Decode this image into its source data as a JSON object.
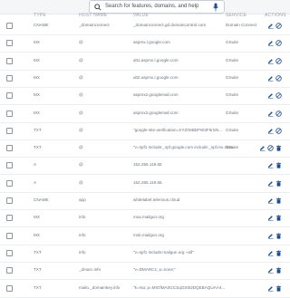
{
  "search": {
    "placeholder_text": "Search for features, domains, and help"
  },
  "colors": {
    "accent": "#1f4f8a",
    "border": "#c9ced4"
  },
  "columns": [
    "TYPE",
    "HOST NAME",
    "VALUE",
    "SERVICE",
    "ACTIONS"
  ],
  "records": [
    {
      "type": "CNAME",
      "host": "_domainconnect",
      "value": "_domainconnect.gd.domaincontrol.com",
      "service": "Domain Connect",
      "actions": [
        "edit",
        "block"
      ]
    },
    {
      "type": "MX",
      "host": "@",
      "value": "aspmx.l.google.com",
      "service": "GSuite",
      "actions": [
        "edit",
        "block"
      ]
    },
    {
      "type": "MX",
      "host": "@",
      "value": "alt1.aspmx.l.google.com",
      "service": "GSuite",
      "actions": [
        "edit",
        "block"
      ]
    },
    {
      "type": "MX",
      "host": "@",
      "value": "alt2.aspmx.l.google.com",
      "service": "GSuite",
      "actions": [
        "edit",
        "block"
      ]
    },
    {
      "type": "MX",
      "host": "@",
      "value": "aspmx2.googlemail.com",
      "service": "GSuite",
      "actions": [
        "edit",
        "block"
      ]
    },
    {
      "type": "MX",
      "host": "@",
      "value": "aspmx3.googlemail.com",
      "service": "GSuite",
      "actions": [
        "edit",
        "block"
      ]
    },
    {
      "type": "TXT",
      "host": "@",
      "value": "\"google-site-verification=XYZ0SBDFW3F5rSN...",
      "service": "GSuite",
      "actions": [
        "edit",
        "block"
      ]
    },
    {
      "type": "TXT",
      "host": "@",
      "value": "\"v=spf1 include:_spf.google.com include:_spf.mx.cloudflare...",
      "service": "GSuite",
      "actions": [
        "edit",
        "block",
        "delete"
      ]
    },
    {
      "type": "A",
      "host": "@",
      "value": "162.255.119.65",
      "service": "",
      "actions": [
        "edit",
        "delete"
      ]
    },
    {
      "type": "A",
      "host": "@",
      "value": "162.255.119.65",
      "service": "",
      "actions": [
        "edit",
        "delete"
      ]
    },
    {
      "type": "CNAME",
      "host": "app",
      "value": "whitelabel.telerious.cloud",
      "service": "",
      "actions": [
        "edit",
        "delete"
      ]
    },
    {
      "type": "MX",
      "host": "info",
      "value": "mxa.mailgun.org",
      "service": "",
      "actions": [
        "edit",
        "delete"
      ]
    },
    {
      "type": "MX",
      "host": "info",
      "value": "mxb.mailgun.org",
      "service": "",
      "actions": [
        "edit",
        "delete"
      ]
    },
    {
      "type": "TXT",
      "host": "info",
      "value": "\"v=spf1 include:mailgun.org ~all\"",
      "service": "",
      "actions": [
        "edit",
        "delete"
      ]
    },
    {
      "type": "TXT",
      "host": "_dmarc.info",
      "value": "\"v=DMARC1; p=none;\"",
      "service": "",
      "actions": [
        "edit",
        "delete"
      ]
    },
    {
      "type": "TXT",
      "host": "mailo._domainkey.info",
      "value": "\"k=rsa; p=MIGfMA0GCSqGSIb3DQEBAQUAA4...",
      "service": "",
      "actions": [
        "edit",
        "delete"
      ]
    }
  ]
}
